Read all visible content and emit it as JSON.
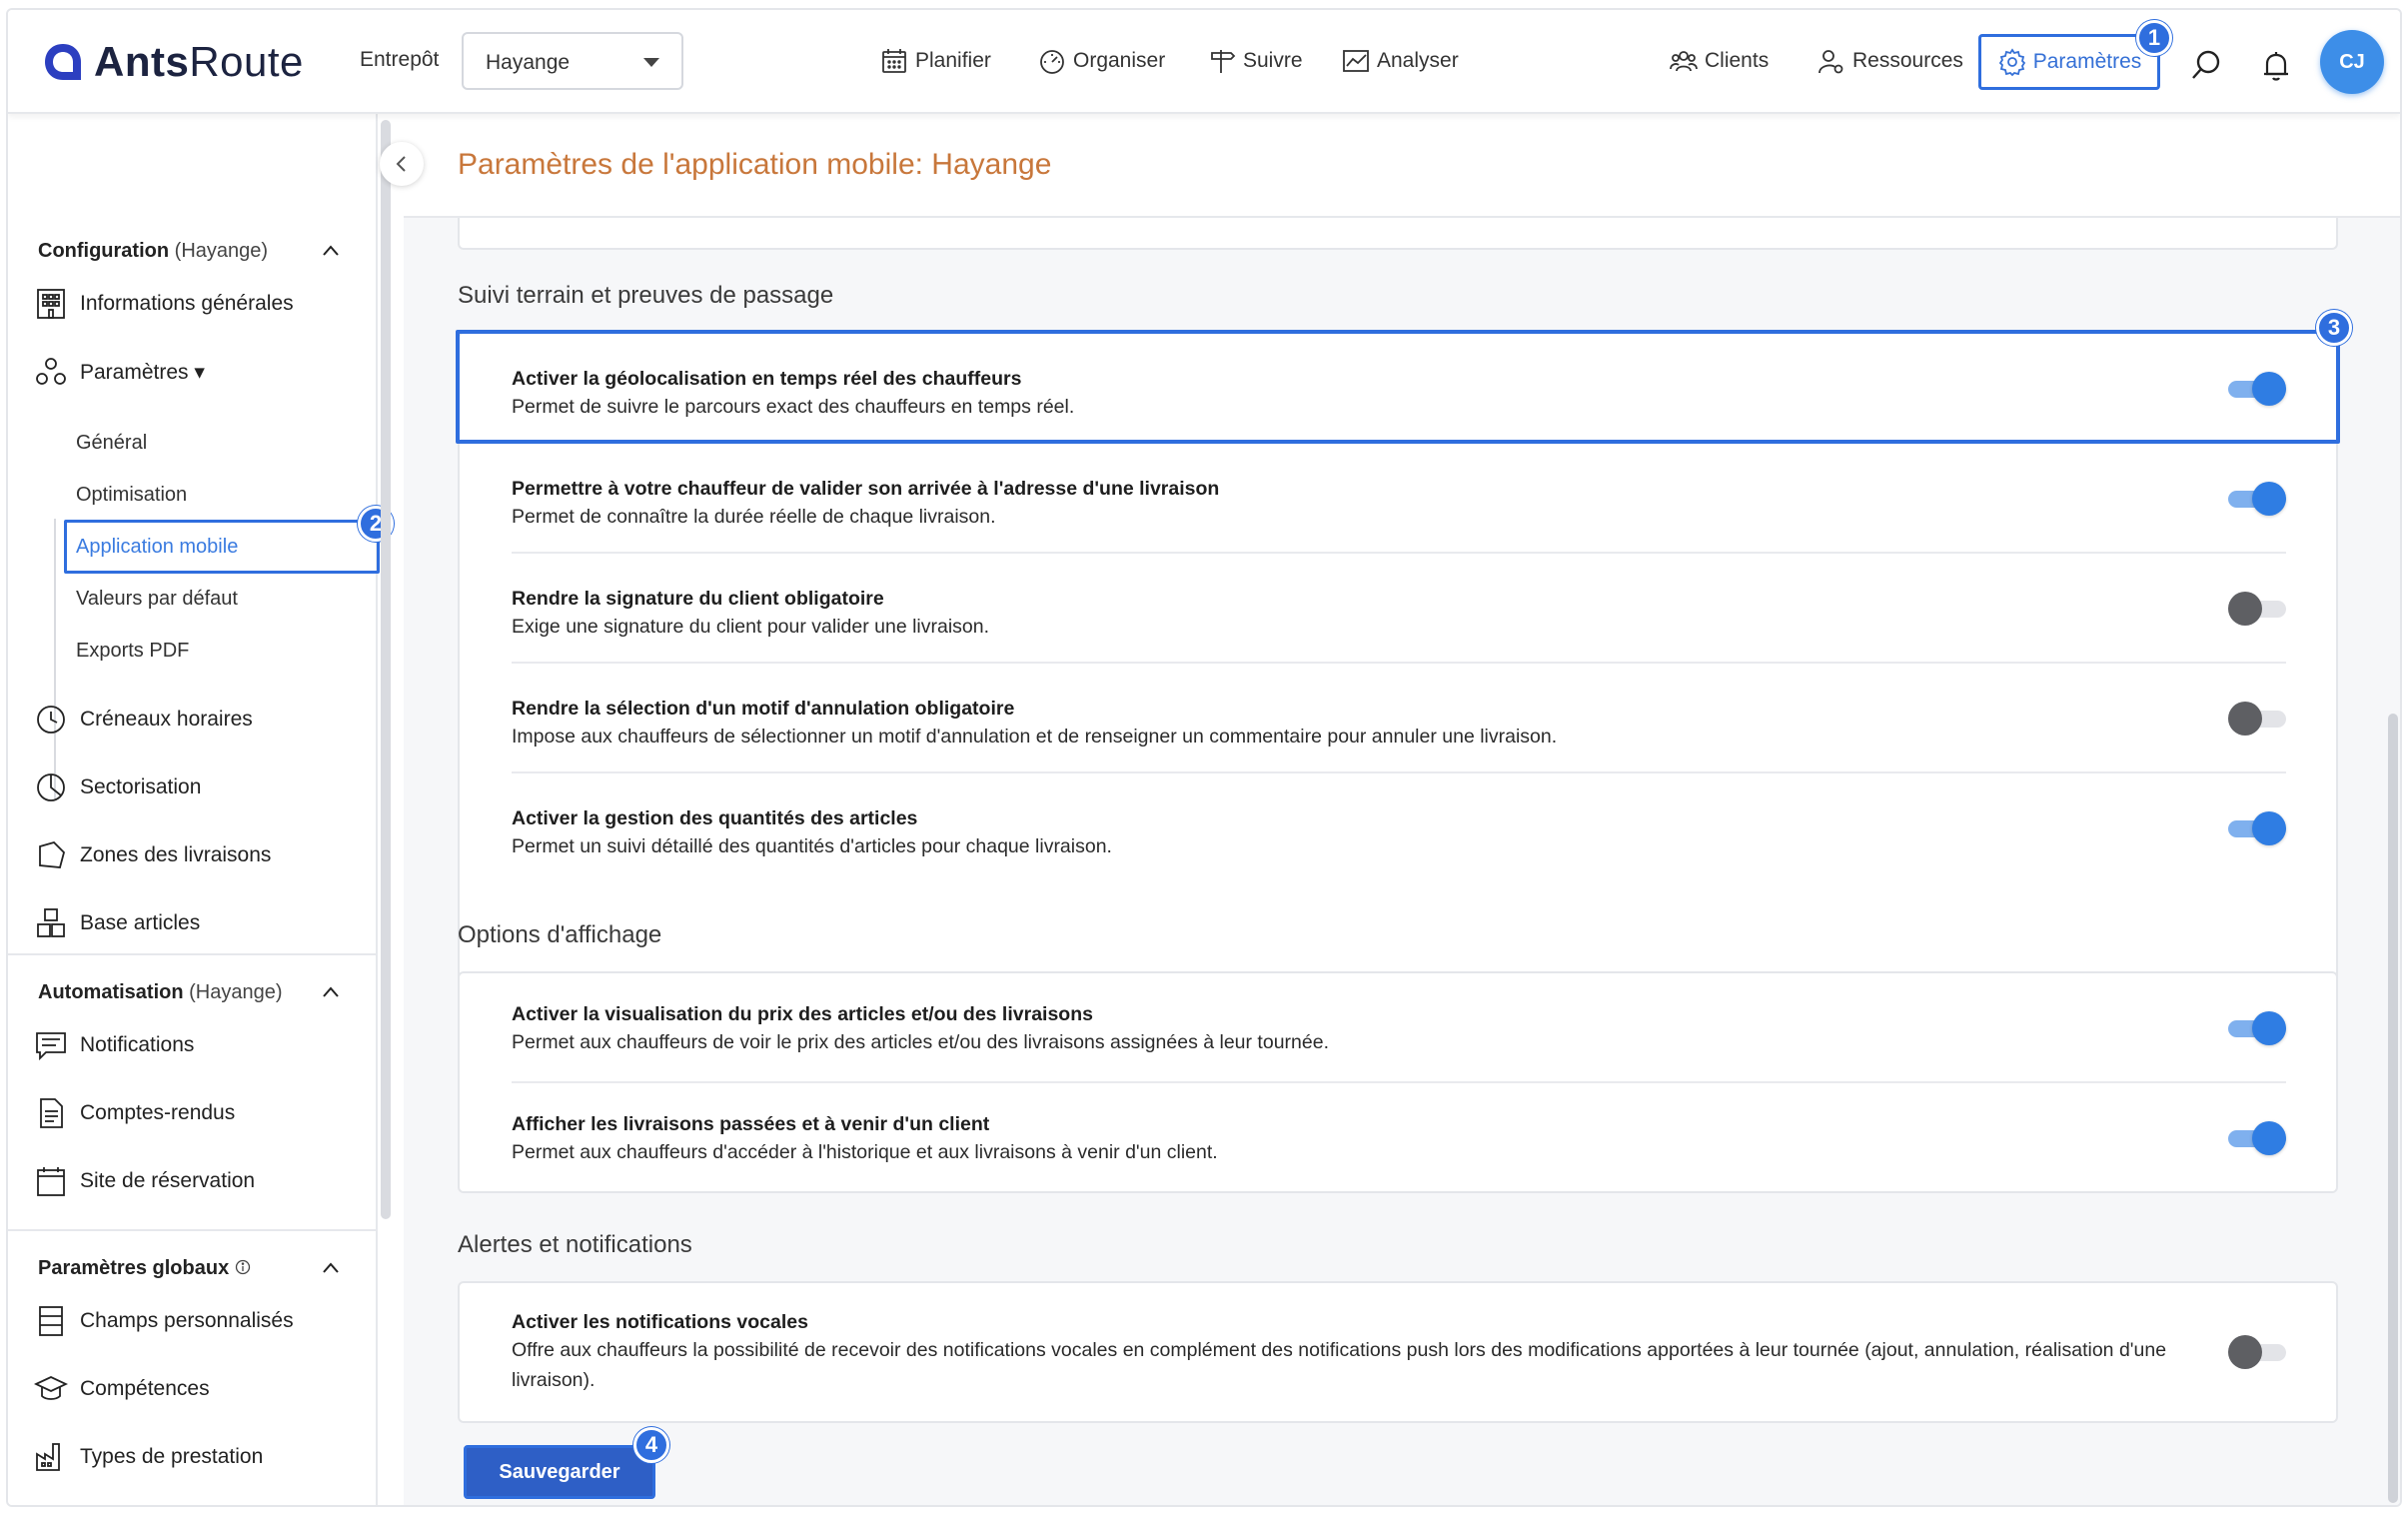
{
  "app": {
    "logo_bold": "Ants",
    "logo_light": "Route"
  },
  "topbar": {
    "entrepot_label": "Entrepôt",
    "entrepot_value": "Hayange",
    "nav": [
      "Planifier",
      "Organiser",
      "Suivre",
      "Analyser"
    ],
    "right_nav": [
      "Clients",
      "Ressources",
      "Paramètres"
    ],
    "avatar": "CJ",
    "badges": [
      "1",
      "2",
      "3",
      "4"
    ]
  },
  "sidebar": {
    "config_title": "Configuration",
    "config_scope": "(Hayange)",
    "items_config": [
      "Informations générales",
      "Paramètres ▾"
    ],
    "sub_items": [
      "Général",
      "Optimisation",
      "Application mobile",
      "Valeurs par défaut",
      "Exports PDF"
    ],
    "items_after": [
      "Créneaux horaires",
      "Sectorisation",
      "Zones des livraisons",
      "Base articles"
    ],
    "auto_title": "Automatisation",
    "auto_scope": "(Hayange)",
    "items_auto": [
      "Notifications",
      "Comptes-rendus",
      "Site de réservation"
    ],
    "global_title": "Paramètres globaux",
    "items_global": [
      "Champs personnalisés",
      "Compétences",
      "Types de prestation"
    ]
  },
  "page": {
    "title": "Paramètres de l'application mobile: Hayange",
    "section1": "Suivi terrain et preuves de passage",
    "section2": "Options d'affichage",
    "section3": "Alertes et notifications",
    "save_label": "Sauvegarder"
  },
  "settings": [
    {
      "title": "Activer la géolocalisation en temps réel des chauffeurs",
      "desc": "Permet de suivre le parcours exact des chauffeurs en temps réel.",
      "enabled": true
    },
    {
      "title": "Permettre à votre chauffeur de valider son arrivée à l'adresse d'une livraison",
      "desc": "Permet de connaître la durée réelle de chaque livraison.",
      "enabled": true
    },
    {
      "title": "Rendre la signature du client obligatoire",
      "desc": "Exige une signature du client pour valider une livraison.",
      "enabled": false
    },
    {
      "title": "Rendre la sélection d'un motif d'annulation obligatoire",
      "desc": "Impose aux chauffeurs de sélectionner un motif d'annulation et de renseigner un commentaire pour annuler une livraison.",
      "enabled": false
    },
    {
      "title": "Activer la gestion des quantités des articles",
      "desc": "Permet un suivi détaillé des quantités d'articles pour chaque livraison.",
      "enabled": true
    },
    {
      "title": "Activer la visualisation du prix des articles et/ou des livraisons",
      "desc": "Permet aux chauffeurs de voir le prix des articles et/ou des livraisons assignées à leur tournée.",
      "enabled": true
    },
    {
      "title": "Afficher les livraisons passées et à venir d'un client",
      "desc": "Permet aux chauffeurs d'accéder à l'historique et aux livraisons à venir d'un client.",
      "enabled": true
    },
    {
      "title": "Activer les notifications vocales",
      "desc": "Offre aux chauffeurs la possibilité de recevoir des notifications vocales en complément des notifications push lors des modifications apportées à leur tournée (ajout, annulation, réalisation d'une livraison).",
      "enabled": false
    }
  ],
  "colors": {
    "accent": "#2f6ede",
    "title_orange": "#c8773b",
    "toggle_on": "#2f7de3",
    "toggle_off": "#5e5f63"
  }
}
